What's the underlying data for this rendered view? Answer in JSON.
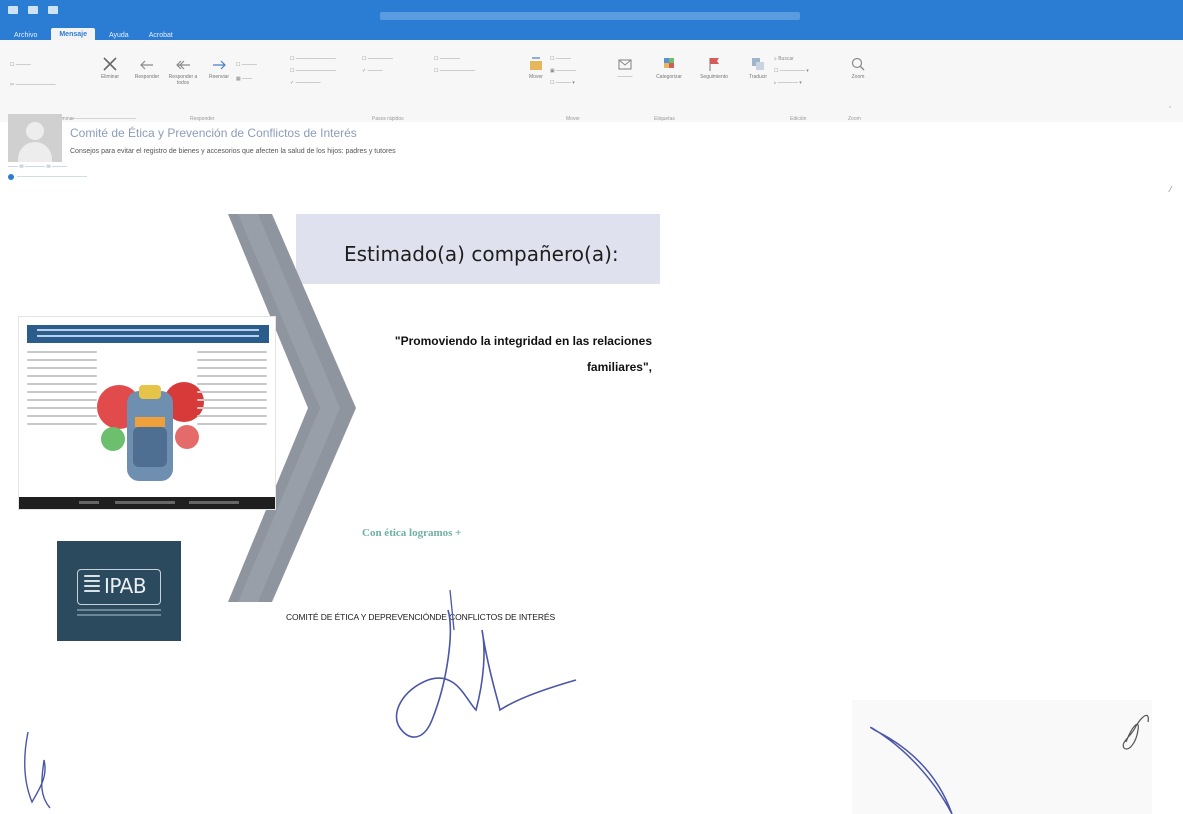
{
  "window": {
    "tabs": [
      "Archivo",
      "Mensaje",
      "Ayuda",
      "Acrobat"
    ],
    "active_tab": "Mensaje"
  },
  "ribbon": {
    "groups": [
      {
        "name": "Eliminar"
      },
      {
        "name": "Responder"
      },
      {
        "name": "Pasos rápidos"
      },
      {
        "name": "Mover"
      },
      {
        "name": "Etiquetas"
      },
      {
        "name": "Edición"
      },
      {
        "name": "Zoom"
      }
    ],
    "buttons": {
      "delete": "Eliminar",
      "reply": "Responder",
      "reply_all": "Responder a todos",
      "forward": "Reenviar",
      "move": "Mover",
      "categorize": "Categorizar",
      "follow_up": "Seguimiento",
      "translate": "Traducir",
      "search": "Buscar",
      "zoom": "Zoom"
    }
  },
  "message": {
    "sender_name": "Comité de Ética y Prevención de Conflictos de Interés",
    "subject": "Consejos para evitar el registro de bienes y accesorios que afecten la salud de los hijos: padres y tutores"
  },
  "body": {
    "greeting": "Estimado(a) compañero(a):",
    "paragraph_lead": "",
    "paragraph_highlight": "\"Promoviendo la integridad en las relaciones familiares\",",
    "paragraph_tail": "",
    "cta": "Con ética logramos +",
    "committee": "COMITÉ DE ÉTICA Y DEPREVENCIÓNDE CONFLICTOS DE INTERÉS",
    "logo_text": "IPAB"
  },
  "colors": {
    "titlebar": "#2b7cd3",
    "banner": "#dfe2ee",
    "chevron": "#8f959f",
    "ipab_bg": "#2c4a5e",
    "cta": "#6db0a2",
    "signature": "#4a56a8"
  }
}
